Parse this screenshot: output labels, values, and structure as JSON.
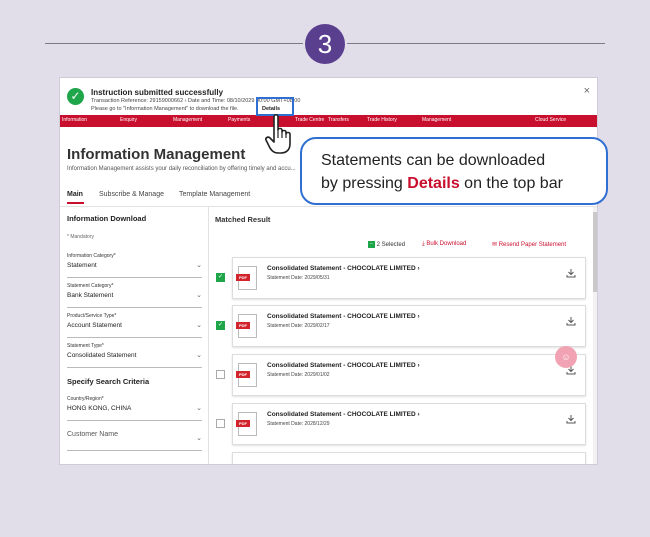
{
  "step": {
    "number": "3"
  },
  "toast": {
    "title": "Instruction submitted successfully",
    "reference_line": "Transaction Reference: 29159000662 ›     Date and Time: 08/10/2029 00:00 GMT+08:00",
    "instruction_line": "Please go to \"Information Management\" to download the file.",
    "details_link": "Details",
    "close": "×"
  },
  "navbar": {
    "items": [
      "Information",
      "Enquiry",
      "Management",
      "Payments",
      "Trade Centre",
      "Transfers",
      "Trade History",
      "Management",
      "Cloud Service"
    ]
  },
  "page": {
    "title": "Information Management",
    "subtitle": "Information Management assists your daily reconciliation by offering timely and accu...",
    "tabs": [
      "Main",
      "Subscribe & Manage",
      "Template Management"
    ]
  },
  "left_panel": {
    "heading": "Information Download",
    "mandatory": "* Mandatory",
    "fields": [
      {
        "label": "Information Category*",
        "value": "Statement"
      },
      {
        "label": "Statement Category*",
        "value": "Bank Statement"
      },
      {
        "label": "Product/Service Type*",
        "value": "Account Statement"
      },
      {
        "label": "Statement Type*",
        "value": "Consolidated Statement"
      }
    ],
    "search_heading": "Specify Search Criteria",
    "search_fields": [
      {
        "label": "Country/Region*",
        "value": "HONG KONG, CHINA"
      },
      {
        "label": "",
        "value": "Customer Name"
      }
    ]
  },
  "results": {
    "title": "Matched Result",
    "selected": "2 Selected",
    "bulk_download": "Bulk Download",
    "resend": "Resend Paper Statement",
    "rows": [
      {
        "name": "Consolidated Statement - CHOCOLATE LIMITED ›",
        "date": "Statement Date: 2029/05/31",
        "checked": true
      },
      {
        "name": "Consolidated Statement - CHOCOLATE LIMITED ›",
        "date": "Statement Date: 2029/02/17",
        "checked": true
      },
      {
        "name": "Consolidated Statement - CHOCOLATE LIMITED ›",
        "date": "Statement Date: 2029/01/02",
        "checked": false
      },
      {
        "name": "Consolidated Statement - CHOCOLATE LIMITED ›",
        "date": "Statement Date: 2028/12/29",
        "checked": false
      }
    ],
    "pdf_tag": "PDF"
  },
  "callout": {
    "line1": "Statements can be downloaded",
    "line2_prefix": "by pressing ",
    "line2_emph": "Details",
    "line2_suffix": " on the top bar"
  },
  "colors": {
    "brand_red": "#c8102e",
    "success_green": "#1fa54a",
    "highlight_blue": "#2f6fd1",
    "step_purple": "#5b3f8f"
  },
  "icons": [
    "check-circle-icon",
    "close-icon",
    "hand-pointer-icon",
    "pdf-icon",
    "download-icon",
    "chevron-down-icon"
  ]
}
